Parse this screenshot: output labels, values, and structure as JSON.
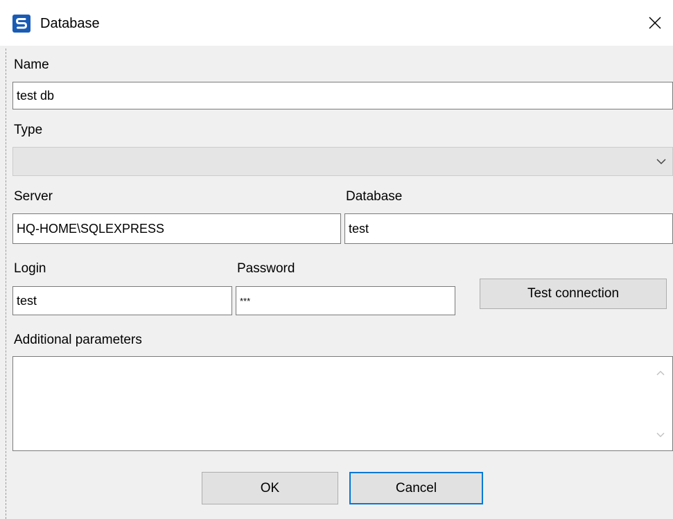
{
  "window": {
    "title": "Database",
    "icon": "sql-app-icon",
    "close_icon": "close-icon"
  },
  "name": {
    "label": "Name",
    "value": "test db"
  },
  "type": {
    "label": "Type",
    "selected": ""
  },
  "server": {
    "label": "Server",
    "value": "HQ-HOME\\SQLEXPRESS"
  },
  "database": {
    "label": "Database",
    "value": "test"
  },
  "login": {
    "label": "Login",
    "value": "test"
  },
  "password": {
    "label": "Password",
    "value": "***"
  },
  "test_connection": {
    "label": "Test connection"
  },
  "additional": {
    "label": "Additional parameters",
    "value": ""
  },
  "buttons": {
    "ok": "OK",
    "cancel": "Cancel"
  },
  "colors": {
    "focus_border": "#0078d7",
    "dialog_bg": "#f0f0f0",
    "icon_blue": "#1a5bb4"
  }
}
